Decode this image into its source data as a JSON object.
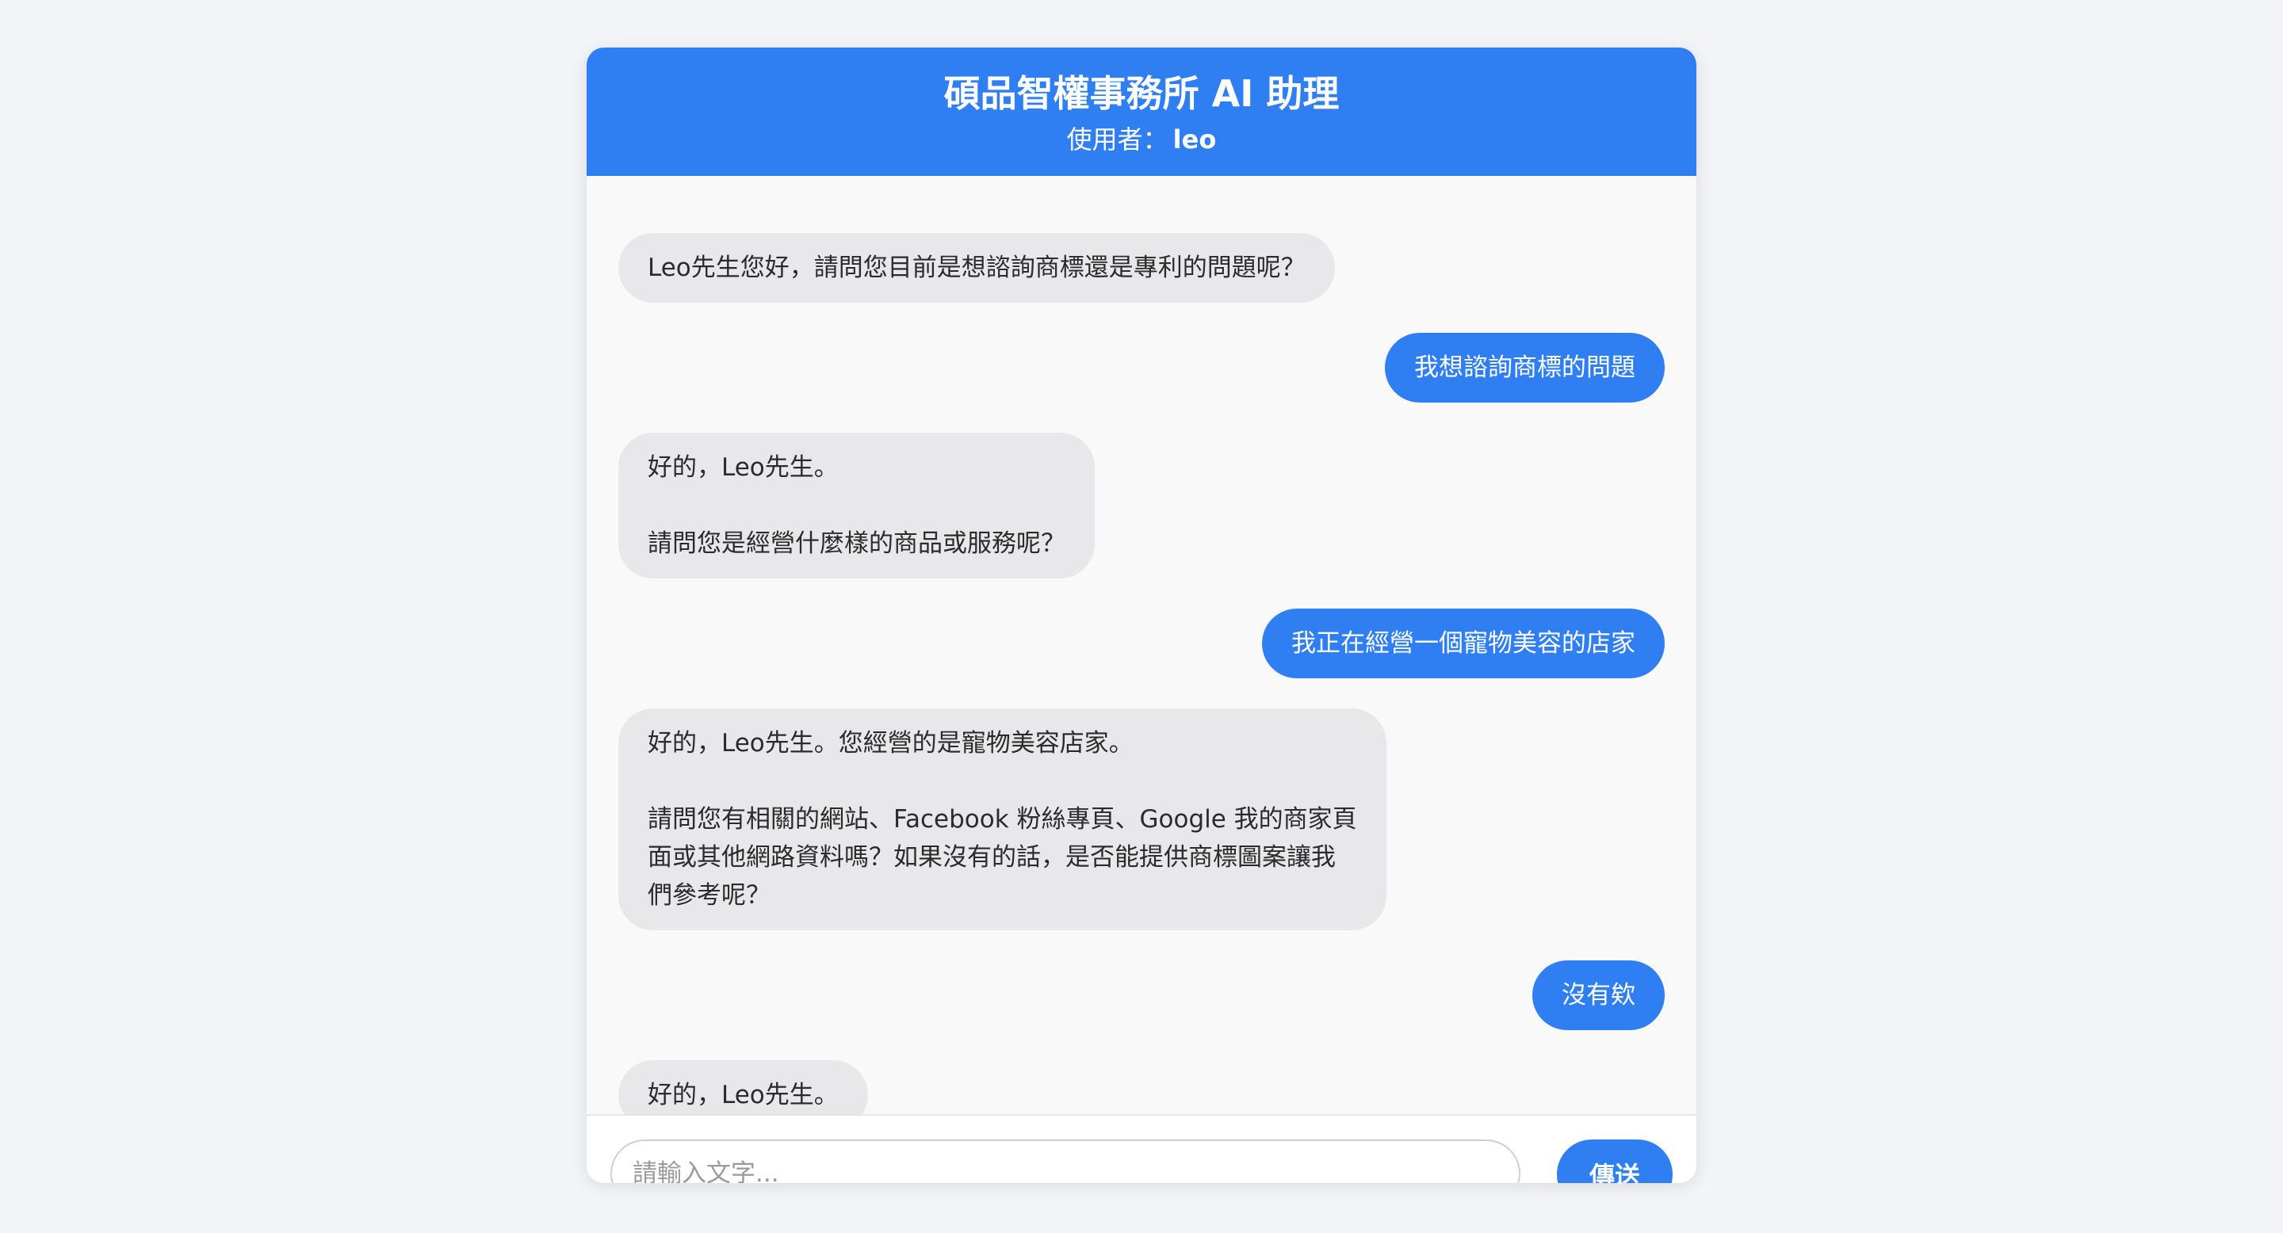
{
  "header": {
    "title": "碩品智權事務所 AI 助理",
    "user_prefix": "使用者：",
    "user_name": "leo"
  },
  "messages": [
    {
      "role": "bot",
      "text": "Leo先生您好，請問您目前是想諮詢商標還是專利的問題呢？"
    },
    {
      "role": "user",
      "text": "我想諮詢商標的問題"
    },
    {
      "role": "bot",
      "text": "好的，Leo先生。\n\n請問您是經營什麼樣的商品或服務呢？"
    },
    {
      "role": "user",
      "text": "我正在經營一個寵物美容的店家"
    },
    {
      "role": "bot",
      "text": "好的，Leo先生。您經營的是寵物美容店家。\n\n請問您有相關的網站、Facebook 粉絲專頁、Google 我的商家頁\n面或其他網路資料嗎？如果沒有的話，是否能提供商標圖案讓我\n們參考呢？"
    },
    {
      "role": "user",
      "text": "沒有欸"
    },
    {
      "role": "bot",
      "text": "好的，Leo先生。"
    }
  ],
  "input": {
    "placeholder": "請輸入文字...",
    "value": ""
  },
  "send_label": "傳送",
  "colors": {
    "accent": "#2f7ff2",
    "bot_bubble": "#e8e8ea",
    "page_bg": "#f2f4f7"
  }
}
